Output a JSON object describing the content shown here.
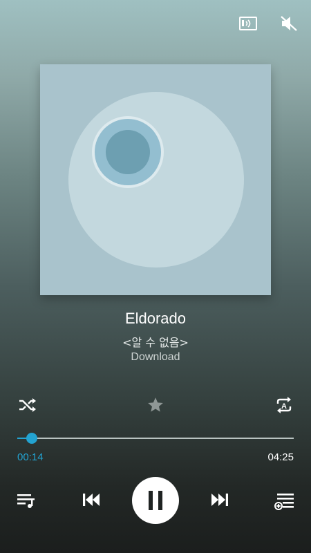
{
  "track": {
    "title": "Eldorado",
    "artist": "<알 수 없음>",
    "album": "Download"
  },
  "playback": {
    "elapsed": "00:14",
    "total": "04:25",
    "progress_fraction": 0.053,
    "state": "playing"
  },
  "icons": {
    "cast": "cast-screen-icon",
    "mute": "volume-mute-icon",
    "shuffle": "shuffle-icon",
    "favorite": "star-icon",
    "repeat": "repeat-a-icon",
    "playlist": "playlist-music-icon",
    "previous": "skip-previous-icon",
    "pause": "pause-icon",
    "next": "skip-next-icon",
    "queue": "add-to-queue-icon"
  },
  "colors": {
    "accent": "#23a3d1",
    "text_primary": "#ffffff",
    "icon": "#ffffff",
    "icon_inactive": "#8f9796"
  }
}
